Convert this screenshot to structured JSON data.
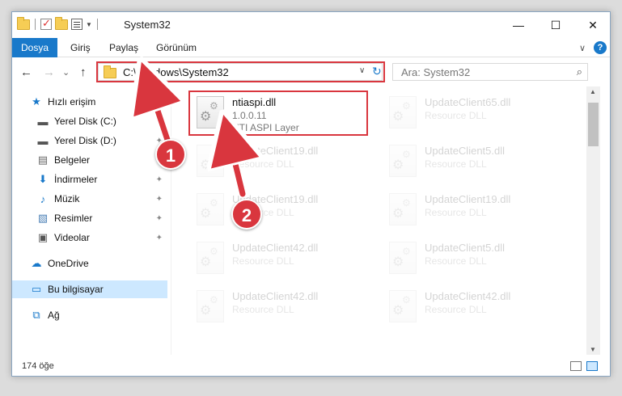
{
  "window": {
    "title": "System32",
    "minimize_glyph": "—",
    "maximize_glyph": "☐",
    "close_glyph": "✕"
  },
  "ribbon": {
    "tabs": [
      "Dosya",
      "Giriş",
      "Paylaş",
      "Görünüm"
    ],
    "help_glyph": "?",
    "expand_glyph": "∨"
  },
  "nav": {
    "back_glyph": "←",
    "forward_glyph": "→",
    "recent_glyph": "⌄",
    "up_glyph": "↑",
    "address": "C:\\Windows\\System32",
    "address_dropdown_glyph": "∨",
    "refresh_glyph": "↻",
    "search_placeholder": "Ara: System32",
    "search_glyph": "⌕"
  },
  "sidebar": {
    "items": [
      {
        "label": "Hızlı erişim",
        "icon": "star-icon",
        "glyph": "★",
        "pinned": false
      },
      {
        "label": "Yerel Disk (C:)",
        "icon": "drive-icon",
        "glyph": "▬",
        "pinned": true
      },
      {
        "label": "Yerel Disk (D:)",
        "icon": "drive-icon",
        "glyph": "▬",
        "pinned": true
      },
      {
        "label": "Belgeler",
        "icon": "document-icon",
        "glyph": "▤",
        "pinned": true
      },
      {
        "label": "İndirmeler",
        "icon": "download-icon",
        "glyph": "⬇",
        "pinned": true
      },
      {
        "label": "Müzik",
        "icon": "music-icon",
        "glyph": "♪",
        "pinned": true
      },
      {
        "label": "Resimler",
        "icon": "picture-icon",
        "glyph": "▧",
        "pinned": true
      },
      {
        "label": "Videolar",
        "icon": "video-icon",
        "glyph": "▣",
        "pinned": true
      },
      {
        "label": "OneDrive",
        "icon": "cloud-icon",
        "glyph": "☁",
        "pinned": false
      },
      {
        "label": "Bu bilgisayar",
        "icon": "computer-icon",
        "glyph": "▭",
        "pinned": false,
        "selected": true
      },
      {
        "label": "Ağ",
        "icon": "network-icon",
        "glyph": "⧉",
        "pinned": false
      }
    ],
    "pin_glyph": "✦"
  },
  "files": [
    {
      "name": "ntiaspi.dll",
      "line1": "1.0.0.11",
      "line2": "NTI ASPI Layer",
      "faded": false
    },
    {
      "name": "UpdateClient65.dll",
      "line1": "Resource DLL",
      "faded": true
    },
    {
      "name": "UpdateClient19.dll",
      "line1": "Resource DLL",
      "faded": true
    },
    {
      "name": "UpdateClient5.dll",
      "line1": "Resource DLL",
      "faded": true
    },
    {
      "name": "UpdateClient19.dll",
      "line1": "Resource DLL",
      "faded": true
    },
    {
      "name": "UpdateClient19.dll",
      "line1": "Resource DLL",
      "faded": true
    },
    {
      "name": "UpdateClient42.dll",
      "line1": "Resource DLL",
      "faded": true
    },
    {
      "name": "UpdateClient5.dll",
      "line1": "Resource DLL",
      "faded": true
    },
    {
      "name": "UpdateClient42.dll",
      "line1": "Resource DLL",
      "faded": true
    },
    {
      "name": "UpdateClient42.dll",
      "line1": "Resource DLL",
      "faded": true
    }
  ],
  "status": {
    "item_count": "174 öğe"
  },
  "annotations": {
    "badge1": "1",
    "badge2": "2",
    "highlight_color": "#d9363e"
  },
  "colors": {
    "accent": "#1979ca",
    "selected_bg": "#cde8ff"
  }
}
